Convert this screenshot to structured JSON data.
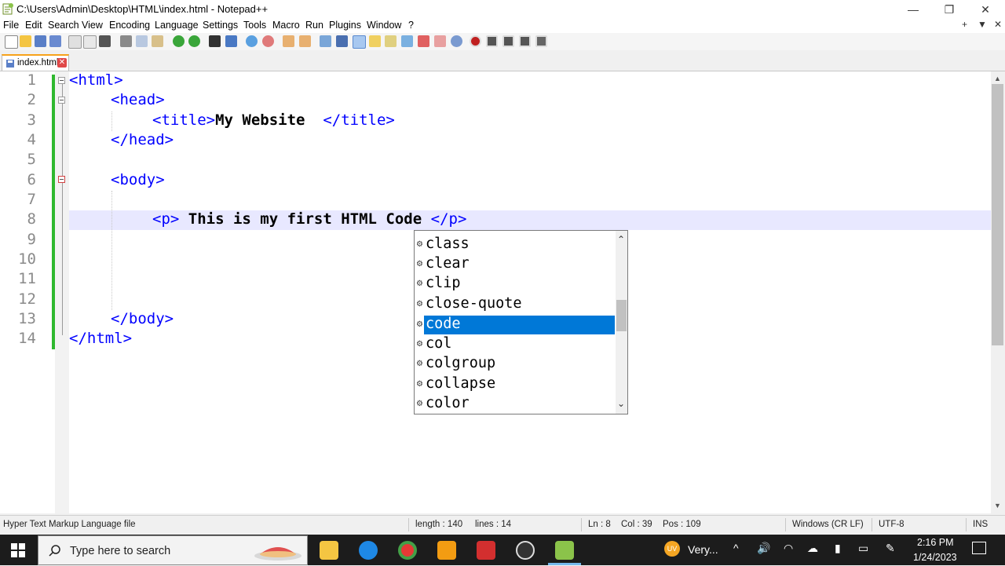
{
  "window": {
    "title": "C:\\Users\\Admin\\Desktop\\HTML\\index.html - Notepad++",
    "minimize": "—",
    "restore": "❐",
    "close": "✕"
  },
  "menu": {
    "items": [
      "File",
      "Edit",
      "Search",
      "View",
      "Encoding",
      "Language",
      "Settings",
      "Tools",
      "Macro",
      "Run",
      "Plugins",
      "Window",
      "?"
    ],
    "right": [
      "+",
      "▼",
      "✕"
    ]
  },
  "tab": {
    "label": "index.html",
    "close": "✕"
  },
  "editor": {
    "line_numbers": [
      "1",
      "2",
      "3",
      "4",
      "5",
      "6",
      "7",
      "8",
      "9",
      "10",
      "11",
      "12",
      "13",
      "14"
    ],
    "lines": {
      "l1_tag": "<html>",
      "l2_tag": "<head>",
      "l3_open": "<title>",
      "l3_text": "My Website  ",
      "l3_close": "</title>",
      "l4_tag": "</head>",
      "l6_tag": "<body>",
      "l8_open": "<p>",
      "l8_text": " This is my first HTML Code ",
      "l8_close": "</p>",
      "l13_tag": "</body>",
      "l14_tag": "</html>"
    },
    "current_line": 8
  },
  "autocomplete": {
    "items": [
      "class",
      "clear",
      "clip",
      "close-quote",
      "code",
      "col",
      "colgroup",
      "collapse",
      "color"
    ],
    "selected": "code",
    "item_icon": "gear-icon",
    "up": "⌃",
    "down": "⌄"
  },
  "status": {
    "file_type": "Hyper Text Markup Language file",
    "length": "length : 140",
    "lines": "lines : 14",
    "ln": "Ln : 8",
    "col": "Col : 39",
    "pos": "Pos : 109",
    "eol": "Windows (CR LF)",
    "encoding": "UTF-8",
    "mode": "INS"
  },
  "taskbar": {
    "search_placeholder": "Type here to search",
    "weather": "Very...",
    "weather_badge": "UV",
    "time": "2:16 PM",
    "date": "1/24/2023"
  },
  "colors": {
    "tag": "#0000ff",
    "selection": "#0078d7",
    "current_line": "#e8e8ff",
    "change_bar": "#2eb82e"
  }
}
